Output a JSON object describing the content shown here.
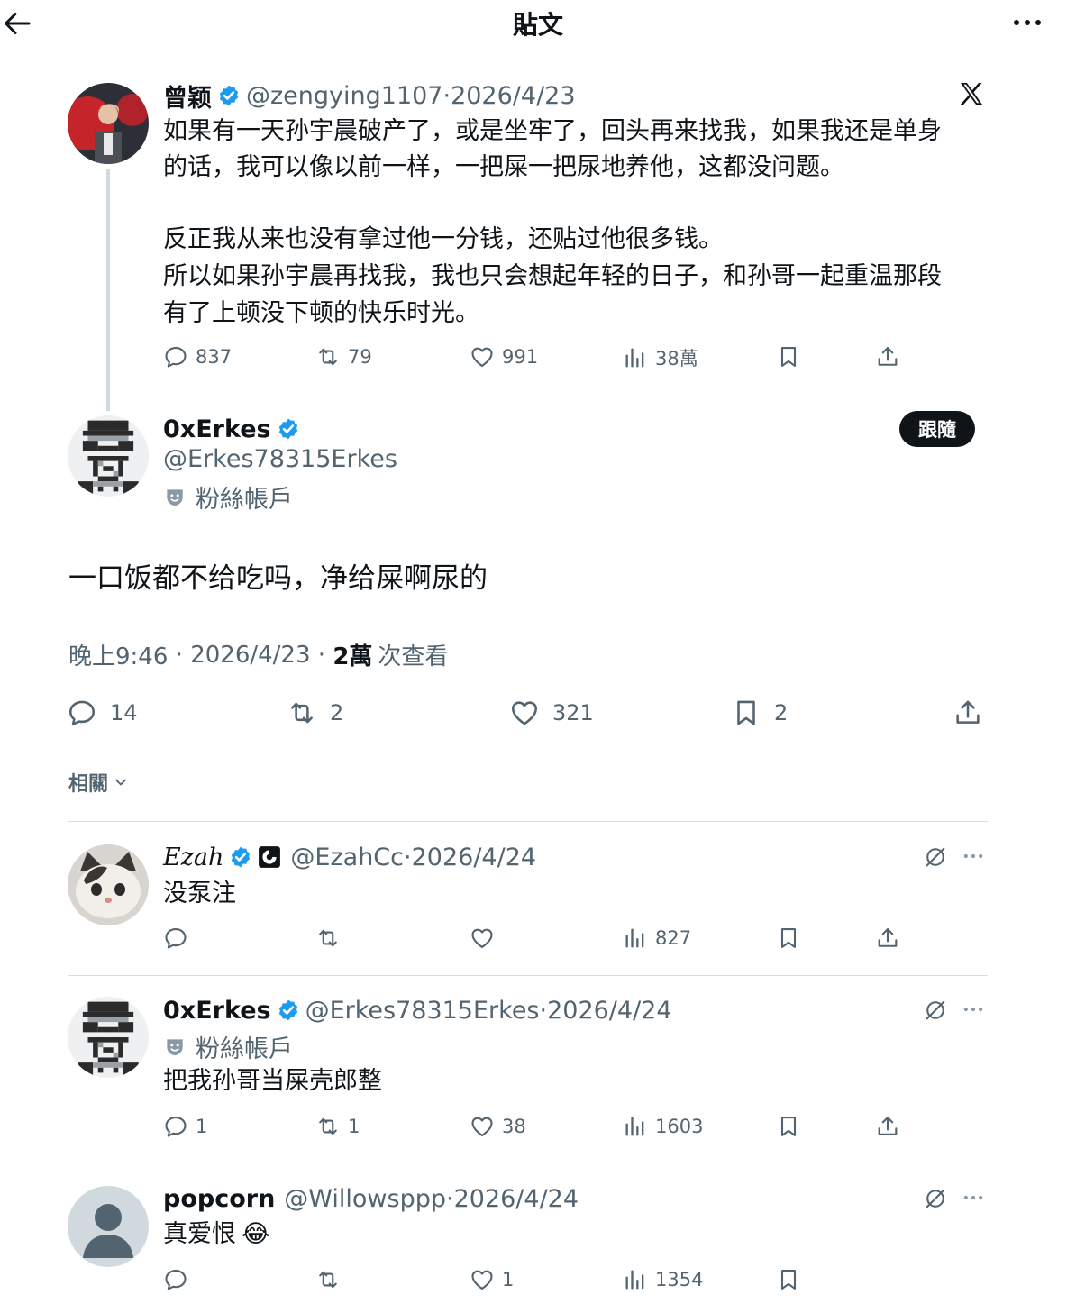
{
  "header": {
    "title": "貼文"
  },
  "parent_tweet": {
    "name": "曾颖",
    "handle": "@zengying1107",
    "date": "2026/4/23",
    "line1": "如果有一天孙宇晨破产了，或是坐牢了，回头再来找我，如果我还是单身",
    "line2": "的话，我可以像以前一样，一把屎一把尿地养他，这都没问题。",
    "line3": "反正我从来也没有拿过他一分钱，还贴过他很多钱。",
    "line4": "所以如果孙宇晨再找我，我也只会想起年轻的日子，和孙哥一起重温那段",
    "line5": "有了上顿没下顿的快乐时光。",
    "replies": "837",
    "retweets": "79",
    "likes": "991",
    "views": "38萬"
  },
  "main_tweet": {
    "name": "0xErkes",
    "handle": "@Erkes78315Erkes",
    "badge": "粉絲帳戶",
    "follow_label": "跟隨",
    "text": "一口饭都不给吃吗，净给屎啊尿的",
    "time": "晚上9:46",
    "date": "2026/4/23",
    "views_count": "2萬",
    "views_label": "次查看",
    "replies": "14",
    "retweets": "2",
    "likes": "321",
    "bookmarks": "2"
  },
  "related": {
    "label": "相關"
  },
  "replies": [
    {
      "name": "Ezah",
      "handle": "@EzahCc",
      "date": "2026/4/24",
      "text": "没泵注",
      "views": "827"
    },
    {
      "name": "0xErkes",
      "handle": "@Erkes78315Erkes",
      "date": "2026/4/24",
      "badge": "粉絲帳戶",
      "text": "把我孙哥当屎壳郎整",
      "replies": "1",
      "retweets": "1",
      "likes": "38",
      "views": "1603"
    },
    {
      "name": "popcorn",
      "handle": "@Willowsppp",
      "date": "2026/4/24",
      "text": "真爱恨",
      "emoji": "😂",
      "likes": "1",
      "views": "1354"
    }
  ],
  "colors": {
    "verified": "#1d9bf0",
    "muted": "#536471",
    "text": "#0f1419",
    "divider": "#dadde0"
  },
  "icons": [
    "back-arrow-icon",
    "more-icon",
    "x-logo-icon",
    "verified-icon",
    "reply-icon",
    "retweet-icon",
    "like-icon",
    "views-icon",
    "bookmark-icon",
    "share-icon",
    "grok-icon",
    "fan-badge-icon",
    "chevron-down-icon"
  ]
}
